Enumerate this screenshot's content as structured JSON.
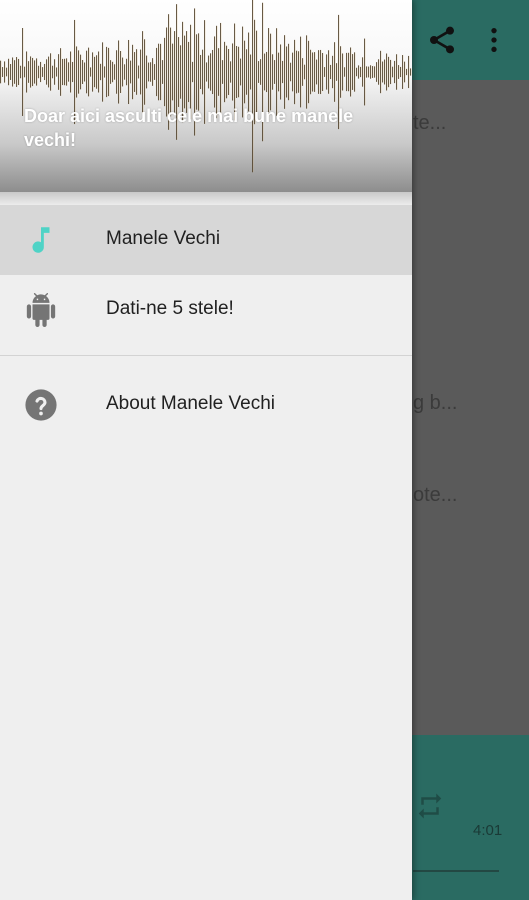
{
  "app": {
    "rows": [
      "te...",
      "g b...",
      "ote..."
    ],
    "player": {
      "time": "4:01"
    },
    "icons": {
      "share": "share-icon",
      "more": "more-vert-icon",
      "repeat": "repeat-icon"
    }
  },
  "drawer": {
    "header_text": "Doar aici asculti cele mai bune manele vechi!",
    "items": [
      {
        "label": "Manele Vechi",
        "icon": "music-note-icon",
        "active": true
      },
      {
        "label": "Dati-ne 5 stele!",
        "icon": "android-icon",
        "active": false
      },
      {
        "label": "About Manele Vechi",
        "icon": "help-icon",
        "active": false
      }
    ]
  },
  "colors": {
    "accent": "#4fd3c6",
    "appbar": "#2a6b62",
    "drawer_bg": "#efefef",
    "active_item_bg": "#d7d7d7",
    "icon_gray": "#757575"
  }
}
